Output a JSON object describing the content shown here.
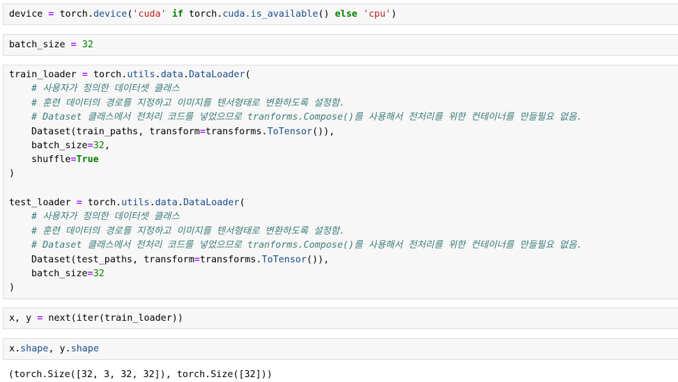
{
  "cells": {
    "device": {
      "var": "device",
      "eq": " = ",
      "t1": "torch.",
      "attr": "device",
      "paren": "(",
      "s1": "'cuda'",
      "kw_if": "if",
      "t2": "torch.",
      "attr2": "cuda.is_available",
      "call": "() ",
      "kw_else": "else",
      "s2": "'cpu'",
      "close": ")"
    },
    "batch": {
      "var": "batch_size",
      "eq": " = ",
      "num": "32"
    },
    "loaders": {
      "train_head_var": "train_loader",
      "train_head_mid": "torch.",
      "attr_utils": "utils",
      "dot1": ".",
      "attr_data": "data",
      "dot2": ".",
      "attr_dl": "DataLoader",
      "open": "(",
      "c1": "# 사용자가 정의한 데이터셋 클래스",
      "c2": "# 훈련 데이터의 경로를 지정하고 이미지를 텐서형태로 변환하도록 설정함.",
      "c3": "# Dataset 클래스에서 전처리 코드를 넣었으므로 tranforms.Compose()를 사용해서 전처리를 위한 컨테이너를 만들필요 없음.",
      "train_ds_pre": "Dataset(train_paths, transform",
      "ds_post_pre": "transforms.",
      "ds_attr": "ToTensor",
      "ds_close": "()),",
      "bs_kw": "batch_size",
      "bs_num": "32",
      "bs_comma": ",",
      "sh_kw": "shuffle",
      "sh_val": "True",
      "close": ")",
      "test_head_var": "test_loader",
      "test_ds_pre": "Dataset(test_paths, transform"
    },
    "next": {
      "text_a": "x, y ",
      "text_b": " next(iter(train_loader))"
    },
    "shape": {
      "x": "x",
      "dot": ".",
      "attr": "shape",
      "mid": ", y",
      "attr2": "shape"
    },
    "output": "(torch.Size([32, 3, 32, 32]), torch.Size([32]))"
  },
  "ops": {
    "eq": "="
  }
}
